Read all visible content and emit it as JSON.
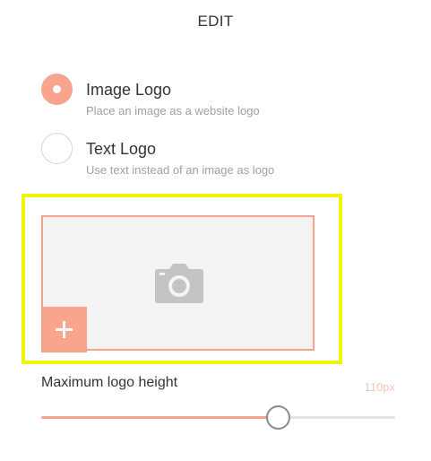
{
  "header": {
    "title": "EDIT"
  },
  "logo_type": {
    "options": [
      {
        "label": "Image Logo",
        "description": "Place an image as a website logo",
        "selected": true
      },
      {
        "label": "Text Logo",
        "description": "Use text instead of an image as logo",
        "selected": false
      }
    ]
  },
  "image_upload": {
    "icon": "camera-icon",
    "add_icon": "plus-icon"
  },
  "logo_height": {
    "label": "Maximum logo height",
    "value": "110px",
    "fill_fraction": 0.67
  },
  "colors": {
    "accent": "#f9a48d",
    "highlight": "#f4f400",
    "muted_text": "#a0a0a0",
    "placeholder_bg": "#f4f4f4"
  }
}
